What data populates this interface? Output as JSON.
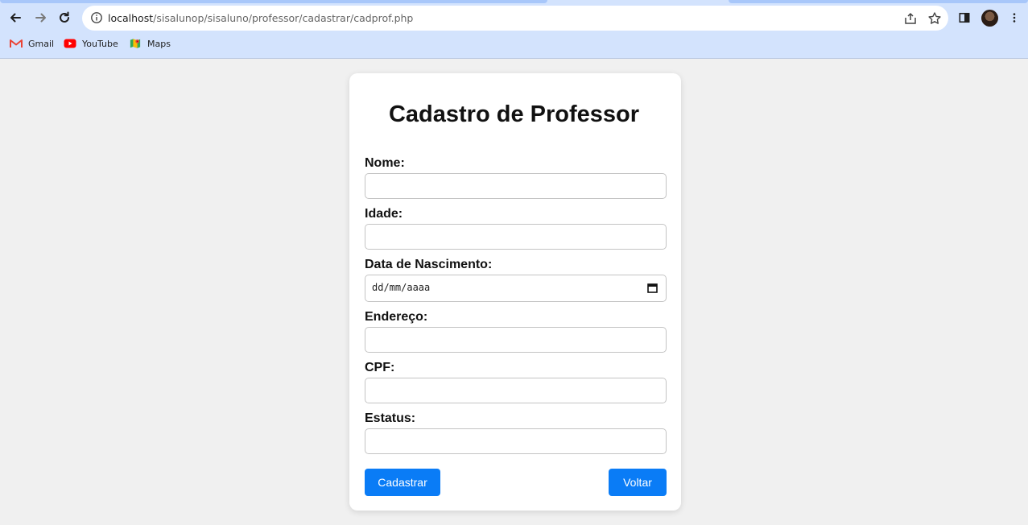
{
  "browser": {
    "url_host": "localhost",
    "url_path": "/sisalunop/sisaluno/professor/cadastrar/cadprof.php",
    "bookmarks": [
      {
        "label": "Gmail",
        "icon": "gmail-icon"
      },
      {
        "label": "YouTube",
        "icon": "youtube-icon"
      },
      {
        "label": "Maps",
        "icon": "maps-icon"
      }
    ]
  },
  "form": {
    "title": "Cadastro de Professor",
    "fields": [
      {
        "label": "Nome:",
        "value": ""
      },
      {
        "label": "Idade:",
        "value": ""
      },
      {
        "label": "Data de Nascimento:",
        "placeholder": "dd/mm/aaaa"
      },
      {
        "label": "Endereço:",
        "value": ""
      },
      {
        "label": "CPF:",
        "value": ""
      },
      {
        "label": "Estatus:",
        "value": ""
      }
    ],
    "submit_label": "Cadastrar",
    "back_label": "Voltar"
  },
  "colors": {
    "chrome_bg": "#d3e3fd",
    "page_bg": "#f0f0f0",
    "button_bg": "#0a7cf6"
  }
}
